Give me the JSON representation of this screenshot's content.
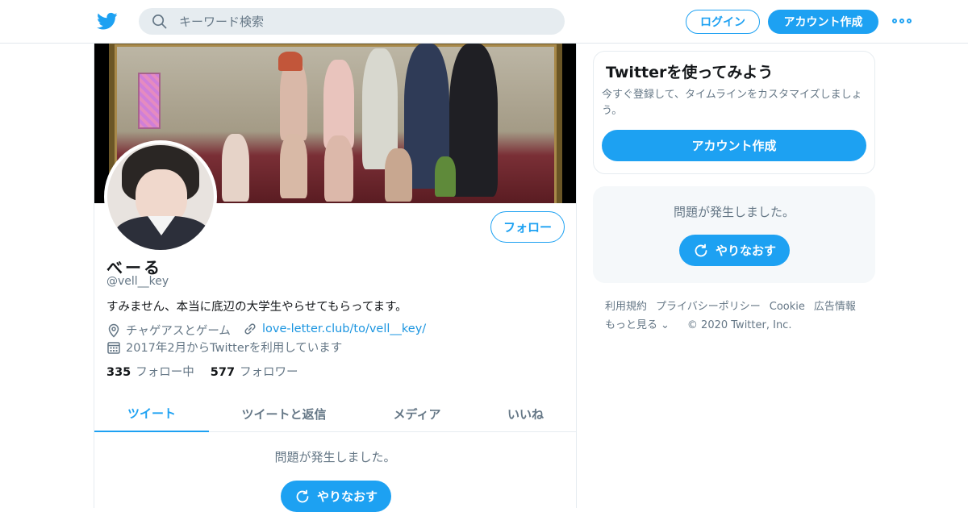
{
  "header": {
    "search_placeholder": "キーワード検索",
    "login_label": "ログイン",
    "signup_label": "アカウント作成",
    "accent_color": "#1da1f2"
  },
  "profile": {
    "display_name": "べーる",
    "handle": "@vell__key",
    "bio": "すみません、本当に底辺の大学生やらせてもらってます。",
    "location": "チャゲアスとゲーム",
    "url": "love-letter.club/to/vell__key/",
    "joined": "2017年2月からTwitterを利用しています",
    "follow_label": "フォロー",
    "following_count": "335",
    "following_label": "フォロー中",
    "followers_count": "577",
    "followers_label": "フォロワー"
  },
  "tabs": [
    {
      "label": "ツイート",
      "active": true
    },
    {
      "label": "ツイートと返信",
      "active": false
    },
    {
      "label": "メディア",
      "active": false
    },
    {
      "label": "いいね",
      "active": false
    }
  ],
  "timeline": {
    "error_text": "問題が発生しました。",
    "retry_label": "やりなおす"
  },
  "sidebar": {
    "signup_title": "Twitterを使ってみよう",
    "signup_desc": "今すぐ登録して、タイムラインをカスタマイズしましょう。",
    "signup_button": "アカウント作成",
    "error_text": "問題が発生しました。",
    "retry_label": "やりなおす"
  },
  "footer": {
    "links": [
      "利用規約",
      "プライバシーポリシー",
      "Cookie",
      "広告情報"
    ],
    "more_label": "もっと見る",
    "copyright": "© 2020 Twitter, Inc."
  }
}
